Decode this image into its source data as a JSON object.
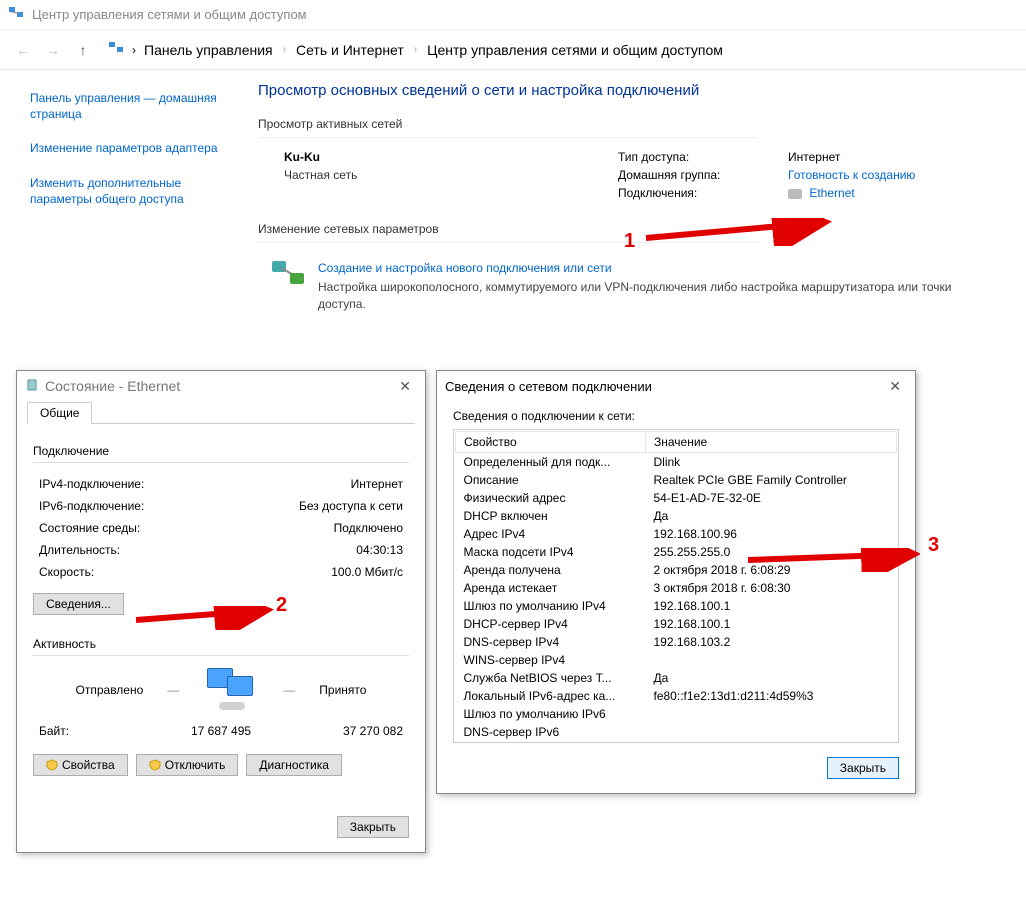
{
  "main": {
    "window_title": "Центр управления сетями и общим доступом",
    "breadcrumb": {
      "root": "Панель управления",
      "mid": "Сеть и Интернет",
      "cur": "Центр управления сетями и общим доступом"
    },
    "sidebar": {
      "home": "Панель управления — домашняя страница",
      "adapter": "Изменение параметров адаптера",
      "sharing": "Изменить дополнительные параметры общего доступа"
    },
    "heading": "Просмотр основных сведений о сети и настройка подключений",
    "active_net_label": "Просмотр активных сетей",
    "network": {
      "name": "Ku-Ku",
      "type": "Частная сеть",
      "access_k": "Тип доступа:",
      "access_v": "Интернет",
      "homegroup_k": "Домашняя группа:",
      "homegroup_v": "Готовность к созданию",
      "conn_k": "Подключения:",
      "conn_v": "Ethernet"
    },
    "change_label": "Изменение сетевых параметров",
    "setup": {
      "title": "Создание и настройка нового подключения или сети",
      "desc": "Настройка широкополосного, коммутируемого или VPN-подключения либо настройка маршрутизатора или точки доступа."
    }
  },
  "status": {
    "title": "Состояние - Ethernet",
    "tab": "Общие",
    "section_conn": "Подключение",
    "ipv4_k": "IPv4-подключение:",
    "ipv4_v": "Интернет",
    "ipv6_k": "IPv6-подключение:",
    "ipv6_v": "Без доступа к сети",
    "media_k": "Состояние среды:",
    "media_v": "Подключено",
    "dur_k": "Длительность:",
    "dur_v": "04:30:13",
    "speed_k": "Скорость:",
    "speed_v": "100.0 Мбит/с",
    "details_btn": "Сведения...",
    "section_activity": "Активность",
    "sent_label": "Отправлено",
    "recv_label": "Принято",
    "bytes_label": "Байт:",
    "sent_bytes": "17 687 495",
    "recv_bytes": "37 270 082",
    "props_btn": "Свойства",
    "disable_btn": "Отключить",
    "diag_btn": "Диагностика",
    "close_btn": "Закрыть"
  },
  "details": {
    "title": "Сведения о сетевом подключении",
    "subtitle": "Сведения о подключении к сети:",
    "col_prop": "Свойство",
    "col_val": "Значение",
    "rows": [
      {
        "k": "Определенный для подк...",
        "v": "Dlink"
      },
      {
        "k": "Описание",
        "v": "Realtek PCIe GBE Family Controller"
      },
      {
        "k": "Физический адрес",
        "v": "54-E1-AD-7E-32-0E"
      },
      {
        "k": "DHCP включен",
        "v": "Да"
      },
      {
        "k": "Адрес IPv4",
        "v": "192.168.100.96"
      },
      {
        "k": "Маска подсети IPv4",
        "v": "255.255.255.0"
      },
      {
        "k": "Аренда получена",
        "v": "2 октября 2018 г. 6:08:29"
      },
      {
        "k": "Аренда истекает",
        "v": "3 октября 2018 г. 6:08:30"
      },
      {
        "k": "Шлюз по умолчанию IPv4",
        "v": "192.168.100.1"
      },
      {
        "k": "DHCP-сервер IPv4",
        "v": "192.168.100.1"
      },
      {
        "k": "DNS-сервер IPv4",
        "v": "192.168.103.2"
      },
      {
        "k": "WINS-сервер IPv4",
        "v": ""
      },
      {
        "k": "Служба NetBIOS через T...",
        "v": "Да"
      },
      {
        "k": "Локальный IPv6-адрес ка...",
        "v": "fe80::f1e2:13d1:d211:4d59%3"
      },
      {
        "k": "Шлюз по умолчанию IPv6",
        "v": ""
      },
      {
        "k": "DNS-сервер IPv6",
        "v": ""
      }
    ],
    "close_btn": "Закрыть"
  },
  "annotations": {
    "n1": "1",
    "n2": "2",
    "n3": "3"
  }
}
